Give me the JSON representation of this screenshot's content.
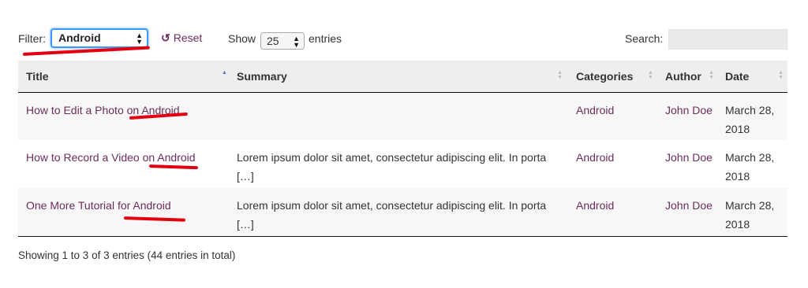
{
  "filter": {
    "label": "Filter:",
    "selected": "Android",
    "reset_label": "Reset"
  },
  "length": {
    "prefix": "Show",
    "selected": "25",
    "suffix": "entries"
  },
  "search": {
    "label": "Search:",
    "value": ""
  },
  "table": {
    "columns": [
      "Title",
      "Summary",
      "Categories",
      "Author",
      "Date"
    ],
    "rows": [
      {
        "title": "How to Edit a Photo on Android",
        "summary": "",
        "category": "Android",
        "author": "John Doe",
        "date_line1": "March 28,",
        "date_line2": "2018"
      },
      {
        "title": "How to Record a Video on Android",
        "summary": "Lorem ipsum dolor sit amet, consectetur adipiscing elit. In porta",
        "summary_more": "[…]",
        "category": "Android",
        "author": "John Doe",
        "date_line1": "March 28,",
        "date_line2": "2018"
      },
      {
        "title": "One More Tutorial for Android",
        "summary": "Lorem ipsum dolor sit amet, consectetur adipiscing elit. In porta",
        "summary_more": "[…]",
        "category": "Android",
        "author": "John Doe",
        "date_line1": "March 28,",
        "date_line2": "2018"
      }
    ]
  },
  "info": "Showing 1 to 3 of 3 entries (44 entries in total)",
  "colors": {
    "link": "#6b2d5c",
    "annotation": "#e3000f",
    "focus": "#3b99fc"
  }
}
